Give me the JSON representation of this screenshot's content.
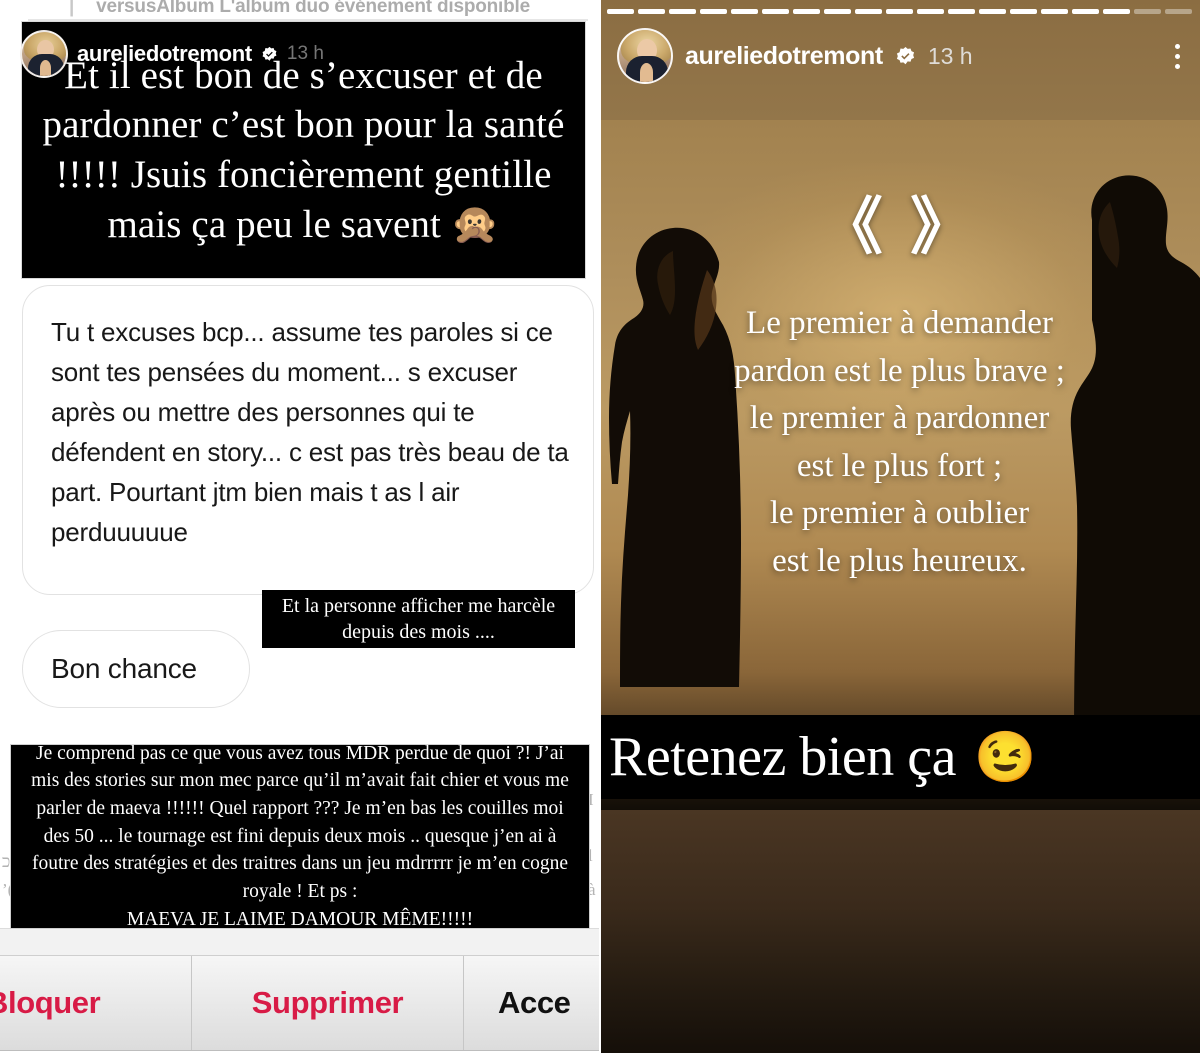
{
  "left_panel": {
    "background_banner": {
      "lead": "|",
      "text": "versusAlbum L'album duo événement disponible"
    },
    "story_overlay": {
      "username": "aureliedotremont",
      "verified_badge": "verified-badge-icon",
      "timestamp": "13 h"
    },
    "story_card": {
      "text": "Et il est bon de s’excuser et de pardonner c’est bon pour la santé !!!!! Jsuis foncièrement gentille mais ça peu le savent 🙊"
    },
    "chat": {
      "incoming_message": "Tu t excuses bcp... assume tes paroles si ce sont tes pensées du moment... s excuser après ou mettre des personnes qui te défendent en story... c est pas très beau de ta part. Pourtant jtm bien mais t as l air perduuuuue",
      "second_message": "Bon chance"
    },
    "mini_quote": {
      "text": "Et la personne afficher me harcèle depuis des mois ...."
    },
    "big_block": {
      "line1": "Je comprend pas ce que vous avez tous MDR perdue de",
      "line2": "quoi ?! J’ai mis des stories sur mon mec parce qu’il m’avait",
      "line3": "fait chier et vous me parler de maeva !!!!!! Quel rapport ??? Je",
      "line4": "m’en bas les couilles moi des 50 ... le tournage est fini depuis",
      "line5": "deux mois .. quesque j’en ai à foutre des stratégies et des",
      "line6": "traitres dans un jeu mdrrrrr je m’en cogne royale ! Et ps :",
      "line7": "MAEVA JE LAIME DAMOUR MÊME!!!!!"
    },
    "action_bar": {
      "block_label": "Bloquer",
      "delete_label": "Supprimer",
      "accept_label": "Acce",
      "danger_color": "#d81b46"
    }
  },
  "right_panel": {
    "progress": {
      "total_segments": 19,
      "watched_segments": 17
    },
    "header": {
      "username": "aureliedotremont",
      "verified_badge": "verified-badge-icon",
      "timestamp": "13 h",
      "menu_icon": "kebab-menu-icon"
    },
    "quote_marks": "《 》",
    "quote": {
      "line1": "Le premier à demander",
      "line2": "pardon est le plus brave ;",
      "line3": "le premier à pardonner",
      "line4": "est le plus fort ;",
      "line5": "le premier à oublier",
      "line6": "est le plus heureux."
    },
    "caption": {
      "text": "Retenez bien ça",
      "emoji": "😉"
    },
    "colors": {
      "sky": "#8e7045",
      "sunset": "#b08a52",
      "caption_bg": "#000000"
    }
  }
}
